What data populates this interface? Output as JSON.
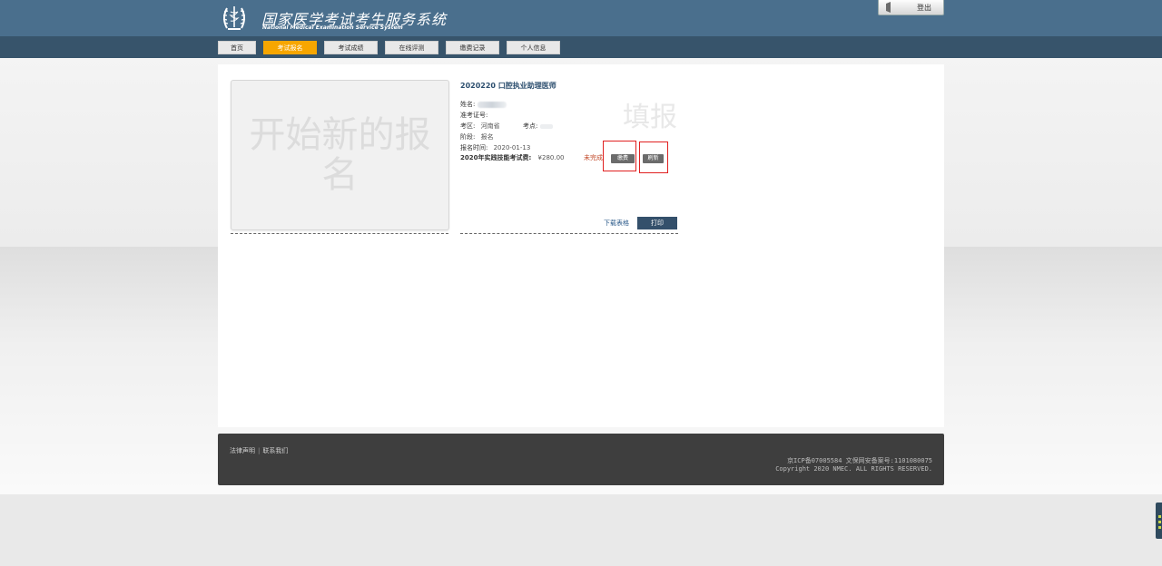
{
  "header": {
    "title_cn": "国家医学考试考生服务系统",
    "title_en": "National Medical Examination Service System",
    "logout_label": "登出"
  },
  "nav": {
    "items": [
      "首页",
      "考试报名",
      "考试成绩",
      "在线评测",
      "缴费记录",
      "个人信息"
    ],
    "active": "考试报名"
  },
  "new_registration": {
    "text": "开始新的报名"
  },
  "card": {
    "title": "2020220 口腔执业助理医师",
    "watermark": "填报",
    "name_label": "姓名:",
    "ticket_label": "准考证号:",
    "region_label": "考区:",
    "region_value": "河南省",
    "site_label": "考点:",
    "stage_label": "阶段:",
    "stage_value": "报名",
    "reg_time_label": "报名时间:",
    "reg_time_value": "2020-01-13",
    "fee_label": "2020年实践技能考试费:",
    "fee_value": "¥280.00",
    "fee_status": "未完成",
    "pay_button": "缴费",
    "refresh_button": "刷新",
    "download_link": "下载表格",
    "print_button": "打印"
  },
  "footer": {
    "legal": "法律声明",
    "contact": "联系我们",
    "separator": "|",
    "icp": "京ICP备07005584 文保网安备案号:1101080075",
    "copyright": "Copyright 2020 NMEC. ALL RIGHTS RESERVED."
  },
  "colors": {
    "header": "#4a6f8d",
    "navbar": "#37546b",
    "active_tab": "#f7a600",
    "highlight_box": "#e02020",
    "print_button": "#34506b",
    "footer": "#3e3e3e"
  }
}
